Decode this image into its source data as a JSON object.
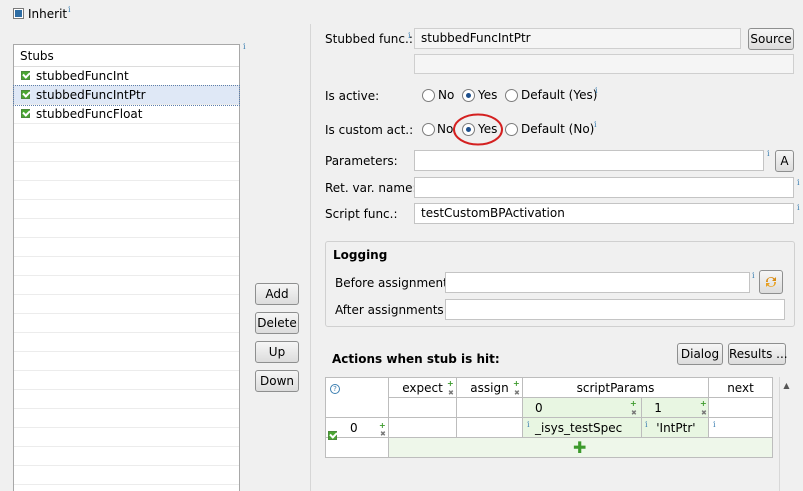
{
  "inherit": {
    "label": "Inherit",
    "checked": true
  },
  "stubs": {
    "header": "Stubs",
    "items": [
      {
        "label": "stubbedFuncInt",
        "checked": true,
        "selected": false
      },
      {
        "label": "stubbedFuncIntPtr",
        "checked": true,
        "selected": true
      },
      {
        "label": "stubbedFuncFloat",
        "checked": true,
        "selected": false
      }
    ]
  },
  "stub_buttons": {
    "add": "Add",
    "delete": "Delete",
    "up": "Up",
    "down": "Down"
  },
  "form": {
    "stubbed_func_label": "Stubbed func.:",
    "stubbed_func_value": "stubbedFuncIntPtr",
    "source_button": "Source",
    "is_active_label": "Is active:",
    "is_active_options": [
      "No",
      "Yes",
      "Default (Yes)"
    ],
    "is_active_selected": "Yes",
    "is_custom_label": "Is custom act.:",
    "is_custom_options": [
      "No",
      "Yes",
      "Default (No)"
    ],
    "is_custom_selected": "Yes",
    "parameters_label": "Parameters:",
    "parameters_value": "",
    "parameters_button": "A",
    "ret_var_label": "Ret. var. name:",
    "ret_var_value": "",
    "script_func_label": "Script func.:",
    "script_func_value": "testCustomBPActivation"
  },
  "logging": {
    "title": "Logging",
    "before_label": "Before assignments:",
    "before_value": "",
    "after_label": "After assignments:",
    "after_value": ""
  },
  "actions": {
    "title": "Actions when stub is hit:",
    "dialog_button": "Dialog",
    "results_button": "Results ..."
  },
  "grid": {
    "columns": [
      "expect",
      "assign",
      "scriptParams",
      "next"
    ],
    "script_param_indices": [
      "0",
      "1"
    ],
    "rows": [
      {
        "index": "0",
        "expect": "",
        "assign": "",
        "script_params": [
          "_isys_testSpec",
          "'IntPtr'"
        ],
        "next": ""
      }
    ]
  },
  "colors": {
    "highlight_circle": "#d42020",
    "selection": "#dfe8f6",
    "grid_green": "#e8f6e2"
  }
}
